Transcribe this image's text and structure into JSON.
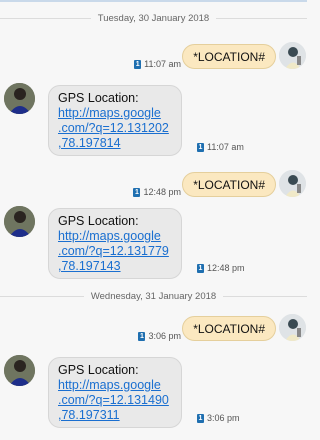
{
  "dates": [
    "Tuesday, 30 January 2018",
    "Wednesday, 31 January 2018"
  ],
  "sim": "1",
  "messages": [
    {
      "text": "*LOCATION#",
      "time": "11:07 am"
    },
    {
      "label": "GPS Location:",
      "link": [
        "http://maps.google",
        ".com/?q=12.131202",
        ",78.197814"
      ],
      "time": "11:07 am"
    },
    {
      "text": "*LOCATION#",
      "time": "12:48 pm"
    },
    {
      "label": "GPS Location:",
      "link": [
        "http://maps.google",
        ".com/?q=12.131779",
        ",78.197143"
      ],
      "time": "12:48 pm"
    },
    {
      "text": "*LOCATION#",
      "time": "3:06 pm"
    },
    {
      "label": "GPS Location:",
      "link": [
        "http://maps.google",
        ".com/?q=12.131490",
        ",78.197311"
      ],
      "time": "3:06 pm"
    }
  ],
  "colors": {
    "outgoing": "#fbe8c0",
    "incoming": "#e9e9e9",
    "link": "#1a6fd0",
    "sim": "#1f6fb0"
  }
}
